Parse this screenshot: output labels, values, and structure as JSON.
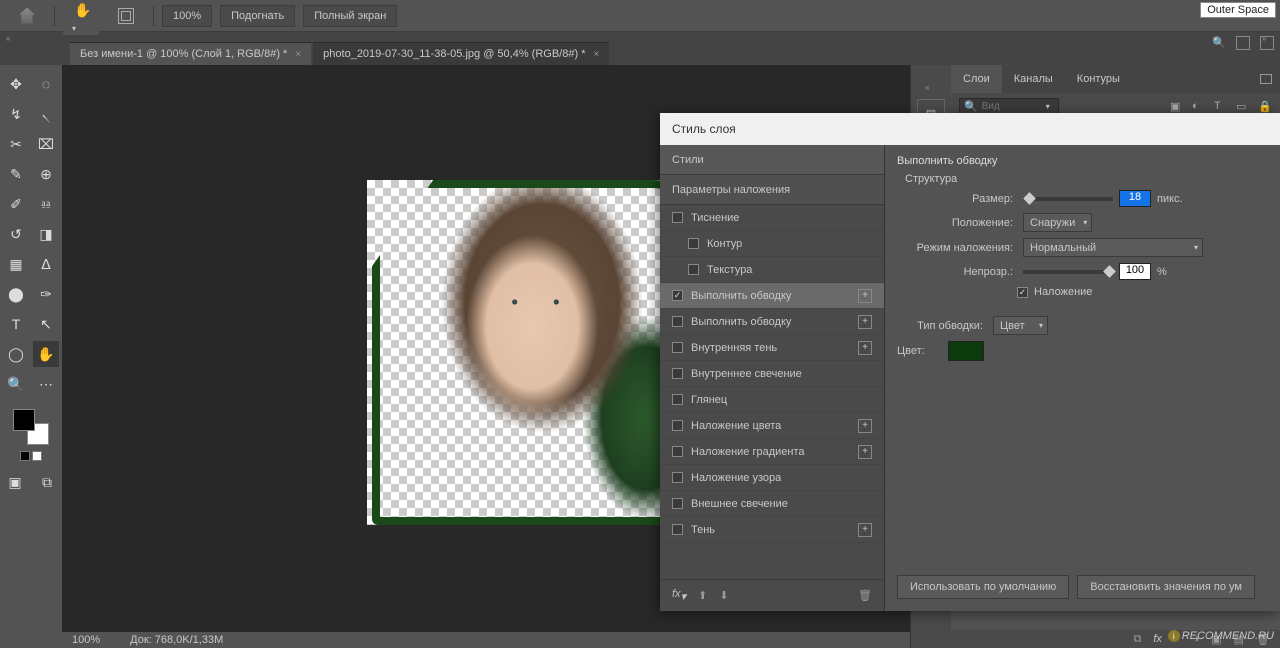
{
  "outer_badge": "Outer Space",
  "topbar": {
    "zoom": "100%",
    "fit": "Подогнать",
    "fullscreen": "Полный экран"
  },
  "tabs": [
    {
      "label": "Без имени-1 @ 100% (Слой 1, RGB/8#) *",
      "active": true
    },
    {
      "label": "photo_2019-07-30_11-38-05.jpg @ 50,4% (RGB/8#) *",
      "active": false
    }
  ],
  "status": {
    "zoom": "100%",
    "doc": "Док: 768,0K/1,33M"
  },
  "right": {
    "tabs": {
      "layers": "Слои",
      "channels": "Каналы",
      "paths": "Контуры"
    },
    "search_placeholder": "Вид"
  },
  "dialog": {
    "title": "Стиль слоя",
    "styles_header": "Стили",
    "blend_header": "Параметры наложения",
    "items": [
      {
        "label": "Тиснение",
        "checked": false,
        "indent": false,
        "plus": false
      },
      {
        "label": "Контур",
        "checked": false,
        "indent": true,
        "plus": false
      },
      {
        "label": "Текстура",
        "checked": false,
        "indent": true,
        "plus": false
      },
      {
        "label": "Выполнить обводку",
        "checked": true,
        "indent": false,
        "plus": true,
        "selected": true
      },
      {
        "label": "Выполнить обводку",
        "checked": false,
        "indent": false,
        "plus": true
      },
      {
        "label": "Внутренняя тень",
        "checked": false,
        "indent": false,
        "plus": true
      },
      {
        "label": "Внутреннее свечение",
        "checked": false,
        "indent": false,
        "plus": false
      },
      {
        "label": "Глянец",
        "checked": false,
        "indent": false,
        "plus": false
      },
      {
        "label": "Наложение цвета",
        "checked": false,
        "indent": false,
        "plus": true
      },
      {
        "label": "Наложение градиента",
        "checked": false,
        "indent": false,
        "plus": true
      },
      {
        "label": "Наложение узора",
        "checked": false,
        "indent": false,
        "plus": false
      },
      {
        "label": "Внешнее свечение",
        "checked": false,
        "indent": false,
        "plus": false
      },
      {
        "label": "Тень",
        "checked": false,
        "indent": false,
        "plus": true
      }
    ],
    "settings": {
      "section_title": "Выполнить обводку",
      "structure": "Структура",
      "size_label": "Размер:",
      "size_value": "18",
      "size_unit": "пикс.",
      "position_label": "Положение:",
      "position_value": "Снаружи",
      "blend_label": "Режим наложения:",
      "blend_value": "Нормальный",
      "opacity_label": "Непрозр.:",
      "opacity_value": "100",
      "opacity_unit": "%",
      "overprint_label": "Наложение",
      "stroke_type_label": "Тип обводки:",
      "stroke_type_value": "Цвет",
      "color_label": "Цвет:",
      "color_value": "#0d3a0d",
      "btn_default": "Использовать по умолчанию",
      "btn_reset": "Восстановить значения по ум"
    }
  },
  "watermark": "RECOMMEND.RU"
}
